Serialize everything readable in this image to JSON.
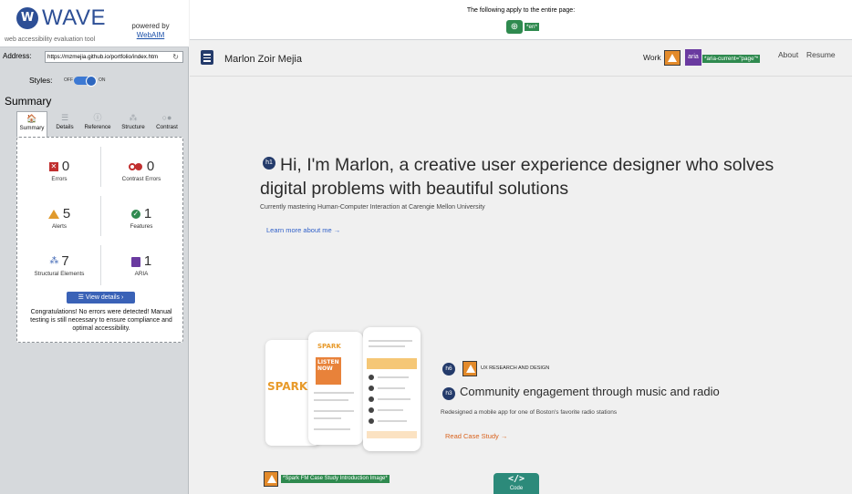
{
  "wave": {
    "logo_letter": "W",
    "title": "WAVE",
    "tagline": "web accessibility evaluation tool",
    "powered_by": "powered by",
    "webaim": "WebAIM",
    "address_label": "Address:",
    "address_value": "https://mzmejia.github.io/portfolio/index.htm",
    "styles_label": "Styles:",
    "styles_off": "OFF",
    "styles_on": "ON",
    "summary_heading": "Summary",
    "tabs": [
      {
        "label": "Summary",
        "icon": "home-icon",
        "glyph": "🏠"
      },
      {
        "label": "Details",
        "icon": "list-icon",
        "glyph": "☰"
      },
      {
        "label": "Reference",
        "icon": "info-icon",
        "glyph": "ⓘ"
      },
      {
        "label": "Structure",
        "icon": "structure-icon",
        "glyph": "⁂"
      },
      {
        "label": "Contrast",
        "icon": "contrast-icon",
        "glyph": "○●"
      }
    ],
    "metrics": {
      "errors": {
        "count": "0",
        "label": "Errors"
      },
      "contrast_errors": {
        "count": "0",
        "label": "Contrast Errors"
      },
      "alerts": {
        "count": "5",
        "label": "Alerts"
      },
      "features": {
        "count": "1",
        "label": "Features"
      },
      "structural": {
        "count": "7",
        "label": "Structural Elements"
      },
      "aria": {
        "count": "1",
        "label": "ARIA"
      }
    },
    "view_details": "View details ›",
    "congrats": "Congratulations! No errors were detected! Manual testing is still necessary to ensure compliance and optimal accessibility."
  },
  "banner": {
    "text": "The following apply to the entire page:",
    "lang_tag": "*en*"
  },
  "site": {
    "name": "Marlon Zoir Mejia",
    "nav_work": "Work",
    "aria_badge": "aria",
    "aria_current_tag": "*aria-current=\"page\"*",
    "nav_about": "About",
    "nav_resume": "Resume",
    "h1_badge": "h1",
    "hero_heading": "Hi, I'm Marlon, a creative user experience designer who solves digital problems with beautiful solutions",
    "hero_sub": "Currently mastering Human-Computer Interaction at Carengie Mellon University",
    "learn_more": "Learn more about me →",
    "h6_badge": "h6",
    "ux_label": "UX RESEARCH AND DESIGN",
    "h3_badge": "h3",
    "case_heading": "Community engagement through music and radio",
    "case_desc": "Redesigned a mobile app for one of Boston's favorite radio stations",
    "read_case": "Read Case Study →",
    "img_alt_tag": "*Spark FM Case Study Introduction Image*",
    "code_symbol": "</>",
    "code_text": "Code",
    "mockup": {
      "splash_logo": "SPARK",
      "phone1_header": "SPARK",
      "phone1_listen": "LISTEN NOW"
    }
  },
  "colors": {
    "wave_blue": "#2d4f96",
    "error_red": "#c12f2f",
    "alert_orange": "#e09a2d",
    "feature_green": "#2f8a4f",
    "aria_purple": "#6a3aa0",
    "link_blue": "#2f5fc8",
    "case_orange": "#d9631e"
  }
}
